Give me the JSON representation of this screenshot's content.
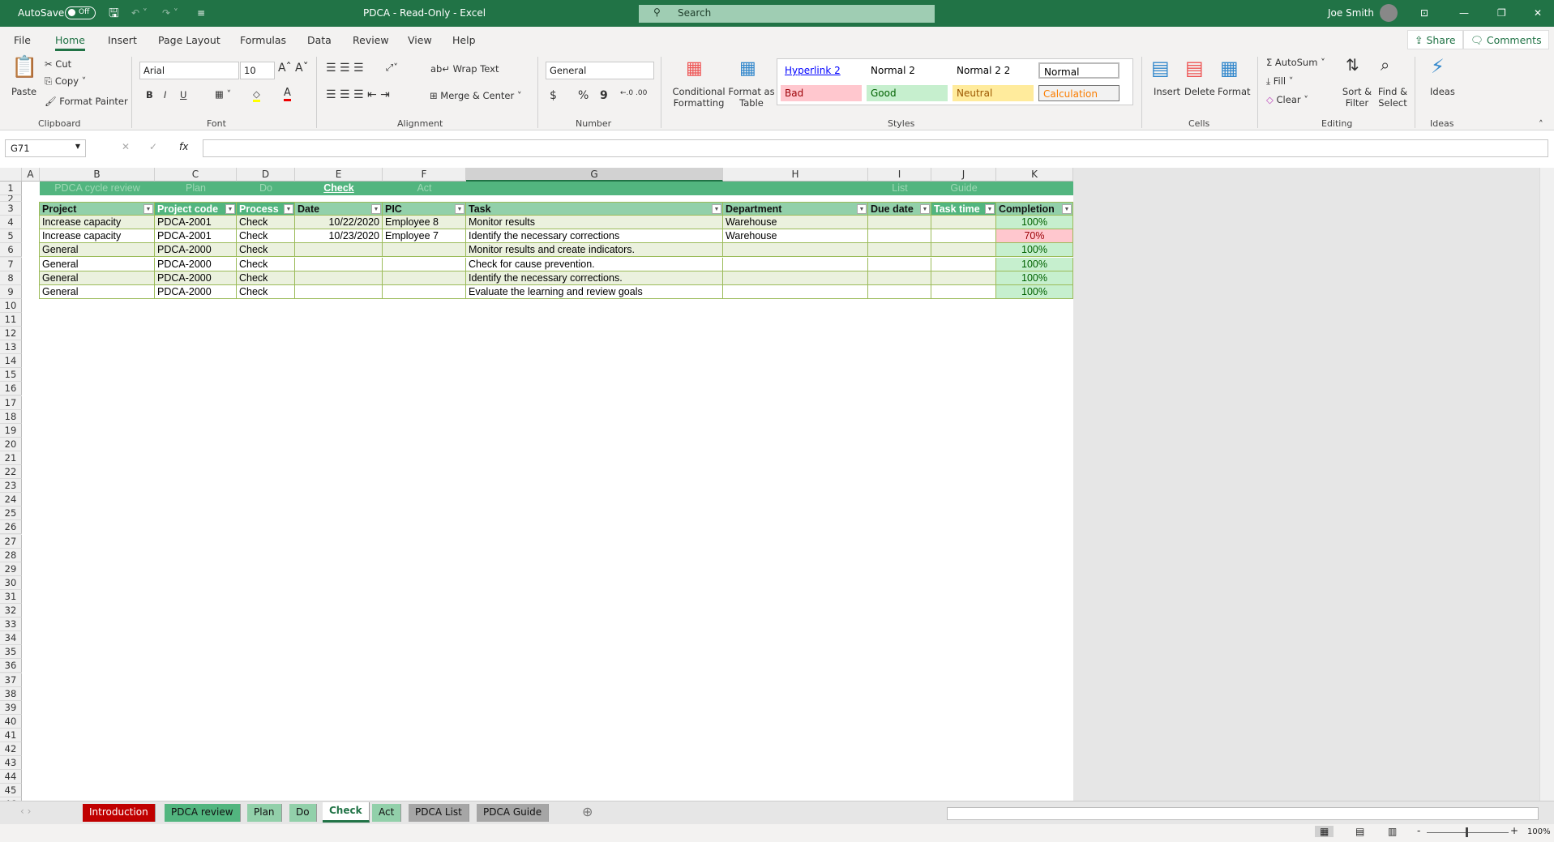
{
  "titlebar": {
    "autosave": "AutoSave",
    "autosave_state": "Off",
    "title": "PDCA  -  Read-Only  -  Excel",
    "search": "Search",
    "user": "Joe Smith"
  },
  "menu": {
    "tabs": [
      "File",
      "Home",
      "Insert",
      "Page Layout",
      "Formulas",
      "Data",
      "Review",
      "View",
      "Help"
    ],
    "share": "Share",
    "comments": "Comments"
  },
  "ribbon": {
    "clipboard": {
      "paste": "Paste",
      "cut": "Cut",
      "copy": "Copy",
      "format_painter": "Format Painter",
      "label": "Clipboard"
    },
    "font": {
      "name": "Arial",
      "size": "10",
      "bold": "B",
      "italic": "I",
      "underline": "U",
      "label": "Font"
    },
    "alignment": {
      "wrap": "Wrap Text",
      "merge": "Merge & Center",
      "label": "Alignment"
    },
    "number": {
      "format": "General",
      "currency": "$",
      "percent": "%",
      "comma": "9",
      "label": "Number"
    },
    "styles": {
      "conditional": "Conditional Formatting",
      "format_table": "Format as Table",
      "items": [
        {
          "label": "Hyperlink 2",
          "bg": "#ffffff",
          "color": "#0000ff"
        },
        {
          "label": "Normal 2",
          "bg": "#ffffff",
          "color": "#000000"
        },
        {
          "label": "Normal 2 2",
          "bg": "#ffffff",
          "color": "#000000"
        },
        {
          "label": "Normal",
          "bg": "#ffffff",
          "color": "#000000"
        },
        {
          "label": "Bad",
          "bg": "#ffc7ce",
          "color": "#9c0006"
        },
        {
          "label": "Good",
          "bg": "#c6efce",
          "color": "#006100"
        },
        {
          "label": "Neutral",
          "bg": "#ffeb9c",
          "color": "#9c5700"
        },
        {
          "label": "Calculation",
          "bg": "#f2f2f2",
          "color": "#fa7d00"
        }
      ],
      "label": "Styles"
    },
    "cells": {
      "insert": "Insert",
      "delete": "Delete",
      "format": "Format",
      "label": "Cells"
    },
    "editing": {
      "autosum": "AutoSum",
      "fill": "Fill",
      "clear": "Clear",
      "sort": "Sort & Filter",
      "find": "Find & Select",
      "label": "Editing"
    },
    "ideas": {
      "ideas": "Ideas",
      "label": "Ideas"
    }
  },
  "formula_bar": {
    "name_box": "G71",
    "fx": "fx",
    "value": ""
  },
  "columns": [
    "A",
    "B",
    "C",
    "D",
    "E",
    "F",
    "G",
    "H",
    "I",
    "J",
    "K"
  ],
  "nav_row": [
    {
      "col": "B",
      "label": "PDCA cycle review"
    },
    {
      "col": "C",
      "label": "Plan"
    },
    {
      "col": "D",
      "label": "Do"
    },
    {
      "col": "E",
      "label": "Check",
      "active": true
    },
    {
      "col": "F",
      "label": "Act"
    },
    {
      "col": "I",
      "label": "List"
    },
    {
      "col": "J",
      "label": "Guide"
    }
  ],
  "table": {
    "headers": [
      "Project",
      "Project code",
      "Process",
      "Date",
      "PIC",
      "Task",
      "Department",
      "Due date",
      "Task time",
      "Completion"
    ],
    "rows": [
      [
        "Increase capacity",
        "PDCA-2001",
        "Check",
        "10/22/2020",
        "Employee 8",
        "Monitor results",
        "Warehouse",
        "",
        "",
        "100%"
      ],
      [
        "Increase capacity",
        "PDCA-2001",
        "Check",
        "10/23/2020",
        "Employee 7",
        "Identify the necessary corrections",
        "Warehouse",
        "",
        "",
        "70%"
      ],
      [
        "General",
        "PDCA-2000",
        "Check",
        "",
        "",
        "Monitor results and create indicators.",
        "",
        "",
        "",
        "100%"
      ],
      [
        "General",
        "PDCA-2000",
        "Check",
        "",
        "",
        "Check for cause prevention.",
        "",
        "",
        "",
        "100%"
      ],
      [
        "General",
        "PDCA-2000",
        "Check",
        "",
        "",
        "Identify the necessary corrections.",
        "",
        "",
        "",
        "100%"
      ],
      [
        "General",
        "PDCA-2000",
        "Check",
        "",
        "",
        "Evaluate the learning and review goals",
        "",
        "",
        "",
        "100%"
      ]
    ]
  },
  "sheet_tabs": [
    {
      "label": "Introduction",
      "bg": "#c00000",
      "color": "#ffffff"
    },
    {
      "label": "PDCA review",
      "bg": "#52b57f",
      "color": "#111"
    },
    {
      "label": "Plan",
      "bg": "#92d0aa",
      "color": "#111"
    },
    {
      "label": "Do",
      "bg": "#92d0aa",
      "color": "#111"
    },
    {
      "label": "Check",
      "bg": "#ffffff",
      "color": "#217346",
      "active": true
    },
    {
      "label": "Act",
      "bg": "#92d0aa",
      "color": "#111"
    },
    {
      "label": "PDCA List",
      "bg": "#a6a6a6",
      "color": "#111"
    },
    {
      "label": "PDCA Guide",
      "bg": "#a6a6a6",
      "color": "#111"
    }
  ],
  "status": {
    "zoom": "100%"
  }
}
